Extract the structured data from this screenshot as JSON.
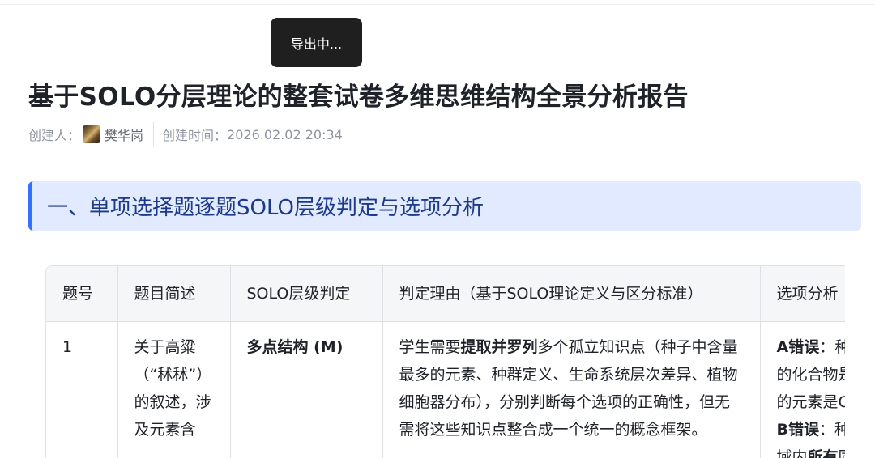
{
  "toast": {
    "label": "导出中..."
  },
  "title": "基于SOLO分层理论的整套试卷多维思维结构全景分析报告",
  "meta": {
    "creator_label": "创建人：",
    "creator_name": "樊华岗",
    "created_label": "创建时间：",
    "created_time": "2026.02.02 20:34"
  },
  "section": {
    "heading": "一、单项选择题逐题SOLO层级判定与选项分析"
  },
  "table": {
    "headers": [
      "题号",
      "题目简述",
      "SOLO层级判定",
      "判定理由（基于SOLO理论定义与区分标准）",
      "选项分析"
    ],
    "rows": [
      {
        "num": "1",
        "summary": "关于高粱（“秫秫”）的叙述，涉及元素含",
        "level": "多点结构 (M)",
        "reason_pre": "学生需要",
        "reason_bold": "提取并罗列",
        "reason_post": "多个孤立知识点（种子中含量最多的元素、种群定义、生命系统层次差异、植物细胞器分布），分别判断每个选项的正确性，但无需将这些知识点整合成一个统一的概念框架。",
        "opt_a_label": "A错误",
        "opt_a_text": "：种子中含量最多的化合物是水，含量最多的元素是O，不是C",
        "opt_b_label": "B错误",
        "opt_b_text": "：种群是指一定区域内",
        "opt_b_bold": "所有",
        "opt_b_post": "同种生物"
      }
    ]
  }
}
